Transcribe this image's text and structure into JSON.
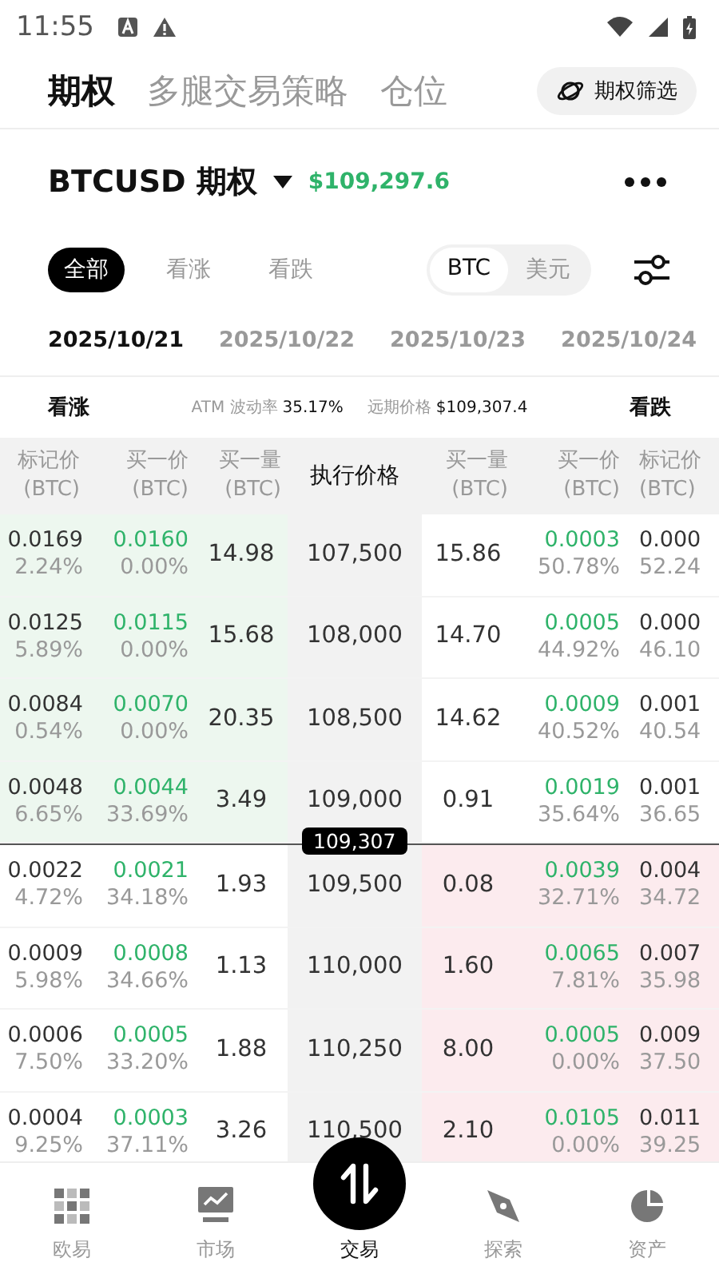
{
  "status_bar": {
    "time": "11:55"
  },
  "top_tabs": [
    {
      "label": "期权",
      "selected": true
    },
    {
      "label": "多腿交易策略",
      "selected": false
    },
    {
      "label": "仓位",
      "selected": false
    }
  ],
  "filter_button": {
    "label": "期权筛选"
  },
  "instrument": {
    "name": "BTCUSD 期权",
    "price": "$109,297.6"
  },
  "side_filters": [
    {
      "label": "全部",
      "selected": true
    },
    {
      "label": "看涨",
      "selected": false
    },
    {
      "label": "看跌",
      "selected": false
    }
  ],
  "currency": [
    {
      "label": "BTC",
      "selected": true
    },
    {
      "label": "美元",
      "selected": false
    }
  ],
  "dates": [
    {
      "label": "2025/10/21",
      "selected": true
    },
    {
      "label": "2025/10/22",
      "selected": false
    },
    {
      "label": "2025/10/23",
      "selected": false
    },
    {
      "label": "2025/10/24",
      "selected": false
    }
  ],
  "info": {
    "calls": "看涨",
    "atm_label": "ATM 波动率",
    "atm_value": "35.17%",
    "forward_label": "远期价格",
    "forward_value": "$109,307.4",
    "puts": "看跌"
  },
  "columns": [
    {
      "title": "标记价",
      "unit": "(BTC)"
    },
    {
      "title": "买一价",
      "unit": "(BTC)"
    },
    {
      "title": "买一量",
      "unit": "(BTC)"
    },
    {
      "title": "执行价格"
    },
    {
      "title": "买一量",
      "unit": "(BTC)"
    },
    {
      "title": "买一价",
      "unit": "(BTC)"
    },
    {
      "title": "标记价",
      "unit": "(BTC)"
    }
  ],
  "rows": [
    {
      "call_itm": true,
      "put_itm": false,
      "call_mark": "0.0169",
      "call_mark_iv": "2.24%",
      "call_bid": "0.0160",
      "call_bid_iv": "0.00%",
      "call_qty": "14.98",
      "strike": "107,500",
      "put_qty": "15.86",
      "put_bid": "0.0003",
      "put_bid_iv": "50.78%",
      "put_mark": "0.000",
      "put_mark_iv": "52.24"
    },
    {
      "call_itm": true,
      "put_itm": false,
      "call_mark": "0.0125",
      "call_mark_iv": "5.89%",
      "call_bid": "0.0115",
      "call_bid_iv": "0.00%",
      "call_qty": "15.68",
      "strike": "108,000",
      "put_qty": "14.70",
      "put_bid": "0.0005",
      "put_bid_iv": "44.92%",
      "put_mark": "0.000",
      "put_mark_iv": "46.10"
    },
    {
      "call_itm": true,
      "put_itm": false,
      "call_mark": "0.0084",
      "call_mark_iv": "0.54%",
      "call_bid": "0.0070",
      "call_bid_iv": "0.00%",
      "call_qty": "20.35",
      "strike": "108,500",
      "put_qty": "14.62",
      "put_bid": "0.0009",
      "put_bid_iv": "40.52%",
      "put_mark": "0.001",
      "put_mark_iv": "40.54"
    },
    {
      "call_itm": true,
      "put_itm": false,
      "call_mark": "0.0048",
      "call_mark_iv": "6.65%",
      "call_bid": "0.0044",
      "call_bid_iv": "33.69%",
      "call_qty": "3.49",
      "strike": "109,000",
      "put_qty": "0.91",
      "put_bid": "0.0019",
      "put_bid_iv": "35.64%",
      "put_mark": "0.001",
      "put_mark_iv": "36.65"
    },
    {
      "call_itm": false,
      "put_itm": true,
      "price_marker": "109,307",
      "call_mark": "0.0022",
      "call_mark_iv": "4.72%",
      "call_bid": "0.0021",
      "call_bid_iv": "34.18%",
      "call_qty": "1.93",
      "strike": "109,500",
      "put_qty": "0.08",
      "put_bid": "0.0039",
      "put_bid_iv": "32.71%",
      "put_mark": "0.004",
      "put_mark_iv": "34.72"
    },
    {
      "call_itm": false,
      "put_itm": true,
      "call_mark": "0.0009",
      "call_mark_iv": "5.98%",
      "call_bid": "0.0008",
      "call_bid_iv": "34.66%",
      "call_qty": "1.13",
      "strike": "110,000",
      "put_qty": "1.60",
      "put_bid": "0.0065",
      "put_bid_iv": "7.81%",
      "put_mark": "0.007",
      "put_mark_iv": "35.98"
    },
    {
      "call_itm": false,
      "put_itm": true,
      "call_mark": "0.0006",
      "call_mark_iv": "7.50%",
      "call_bid": "0.0005",
      "call_bid_iv": "33.20%",
      "call_qty": "1.88",
      "strike": "110,250",
      "put_qty": "8.00",
      "put_bid": "0.0005",
      "put_bid_iv": "0.00%",
      "put_mark": "0.009",
      "put_mark_iv": "37.50"
    },
    {
      "call_itm": false,
      "put_itm": true,
      "call_mark": "0.0004",
      "call_mark_iv": "9.25%",
      "call_bid": "0.0003",
      "call_bid_iv": "37.11%",
      "call_qty": "3.26",
      "strike": "110,500",
      "put_qty": "2.10",
      "put_bid": "0.0105",
      "put_bid_iv": "0.00%",
      "put_mark": "0.011",
      "put_mark_iv": "39.25"
    }
  ],
  "bottom_nav": [
    {
      "kind": "home",
      "label": "欧易",
      "selected": false
    },
    {
      "kind": "market",
      "label": "市场",
      "selected": false
    },
    {
      "kind": "trade",
      "label": "交易",
      "selected": true
    },
    {
      "kind": "explore",
      "label": "探索",
      "selected": false
    },
    {
      "kind": "assets",
      "label": "资产",
      "selected": false
    }
  ]
}
